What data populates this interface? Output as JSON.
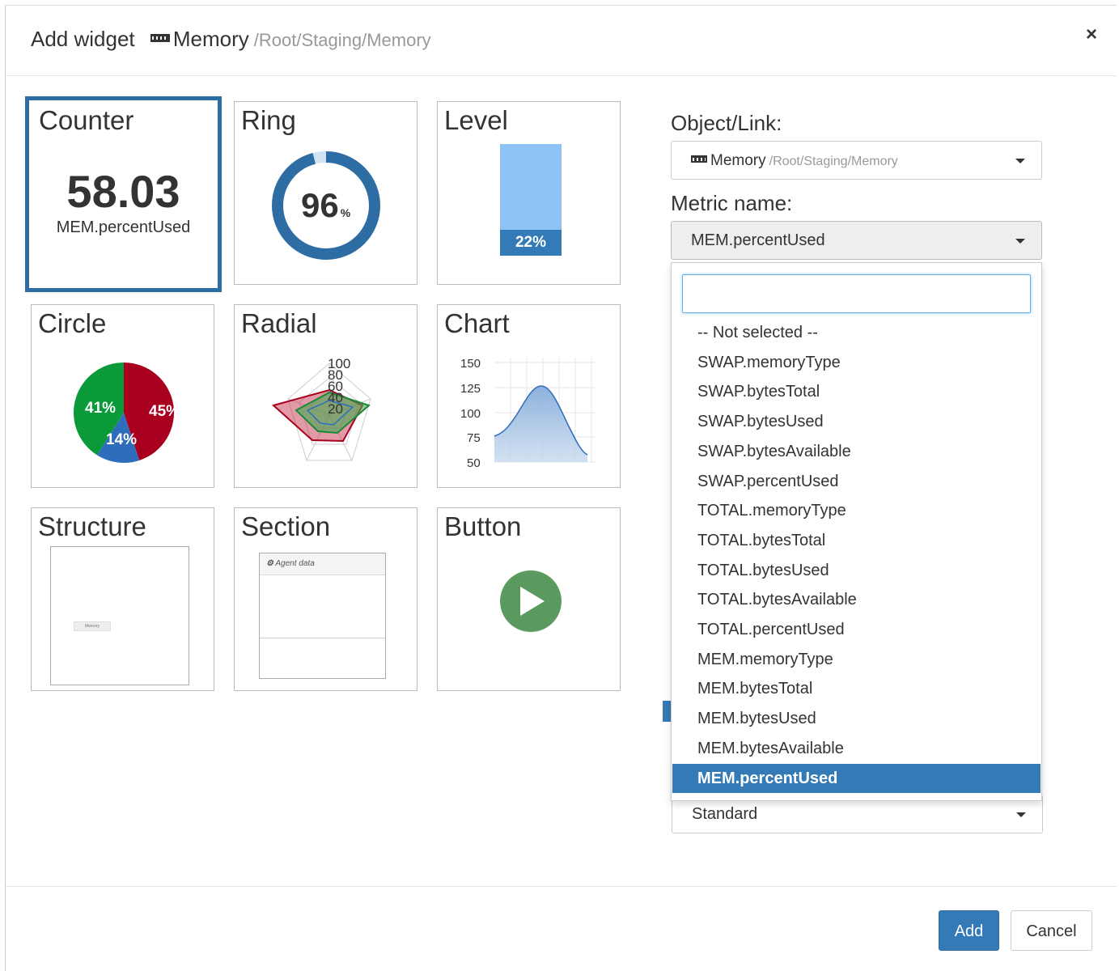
{
  "header": {
    "title": "Add widget",
    "object_name": "Memory",
    "object_path": "/Root/Staging/Memory",
    "close_label": "×"
  },
  "widgets": {
    "counter": {
      "title": "Counter",
      "value": "58.03",
      "metric": "MEM.percentUsed"
    },
    "ring": {
      "title": "Ring",
      "value": "96",
      "unit": "%",
      "fill_fraction": 0.96
    },
    "level": {
      "title": "Level",
      "value_label": "22%",
      "fill_fraction": 0.22
    },
    "circle": {
      "title": "Circle",
      "slices": [
        {
          "label": "45%",
          "value": 45,
          "color": "#a8001e"
        },
        {
          "label": "14%",
          "value": 14,
          "color": "#2e6dbb"
        },
        {
          "label": "41%",
          "value": 41,
          "color": "#0a9a3a"
        }
      ]
    },
    "radial": {
      "title": "Radial",
      "tick_labels": [
        "100",
        "80",
        "60",
        "40",
        "20"
      ]
    },
    "chart": {
      "title": "Chart",
      "y_ticks": [
        "150",
        "125",
        "100",
        "75",
        "50"
      ]
    },
    "structure": {
      "title": "Structure",
      "inner_label": "Memory"
    },
    "section": {
      "title": "Section",
      "inner_title": "Agent data"
    },
    "button": {
      "title": "Button"
    }
  },
  "form": {
    "object_link_label": "Object/Link:",
    "object_link_value": "Memory",
    "object_link_path": "/Root/Staging/Memory",
    "metric_name_label": "Metric name:",
    "metric_name_value": "MEM.percentUsed",
    "style_value": "Standard"
  },
  "dropdown": {
    "search_value": "",
    "options": [
      "-- Not selected --",
      "SWAP.memoryType",
      "SWAP.bytesTotal",
      "SWAP.bytesUsed",
      "SWAP.bytesAvailable",
      "SWAP.percentUsed",
      "TOTAL.memoryType",
      "TOTAL.bytesTotal",
      "TOTAL.bytesUsed",
      "TOTAL.bytesAvailable",
      "TOTAL.percentUsed",
      "MEM.memoryType",
      "MEM.bytesTotal",
      "MEM.bytesUsed",
      "MEM.bytesAvailable",
      "MEM.percentUsed"
    ],
    "highlighted": "MEM.percentUsed"
  },
  "footer": {
    "add_label": "Add",
    "cancel_label": "Cancel"
  },
  "colors": {
    "accent": "#337ab7",
    "ring_blue": "#2e6da4",
    "level_fill": "#8ec3f5",
    "button_green": "#5a9a5e"
  }
}
